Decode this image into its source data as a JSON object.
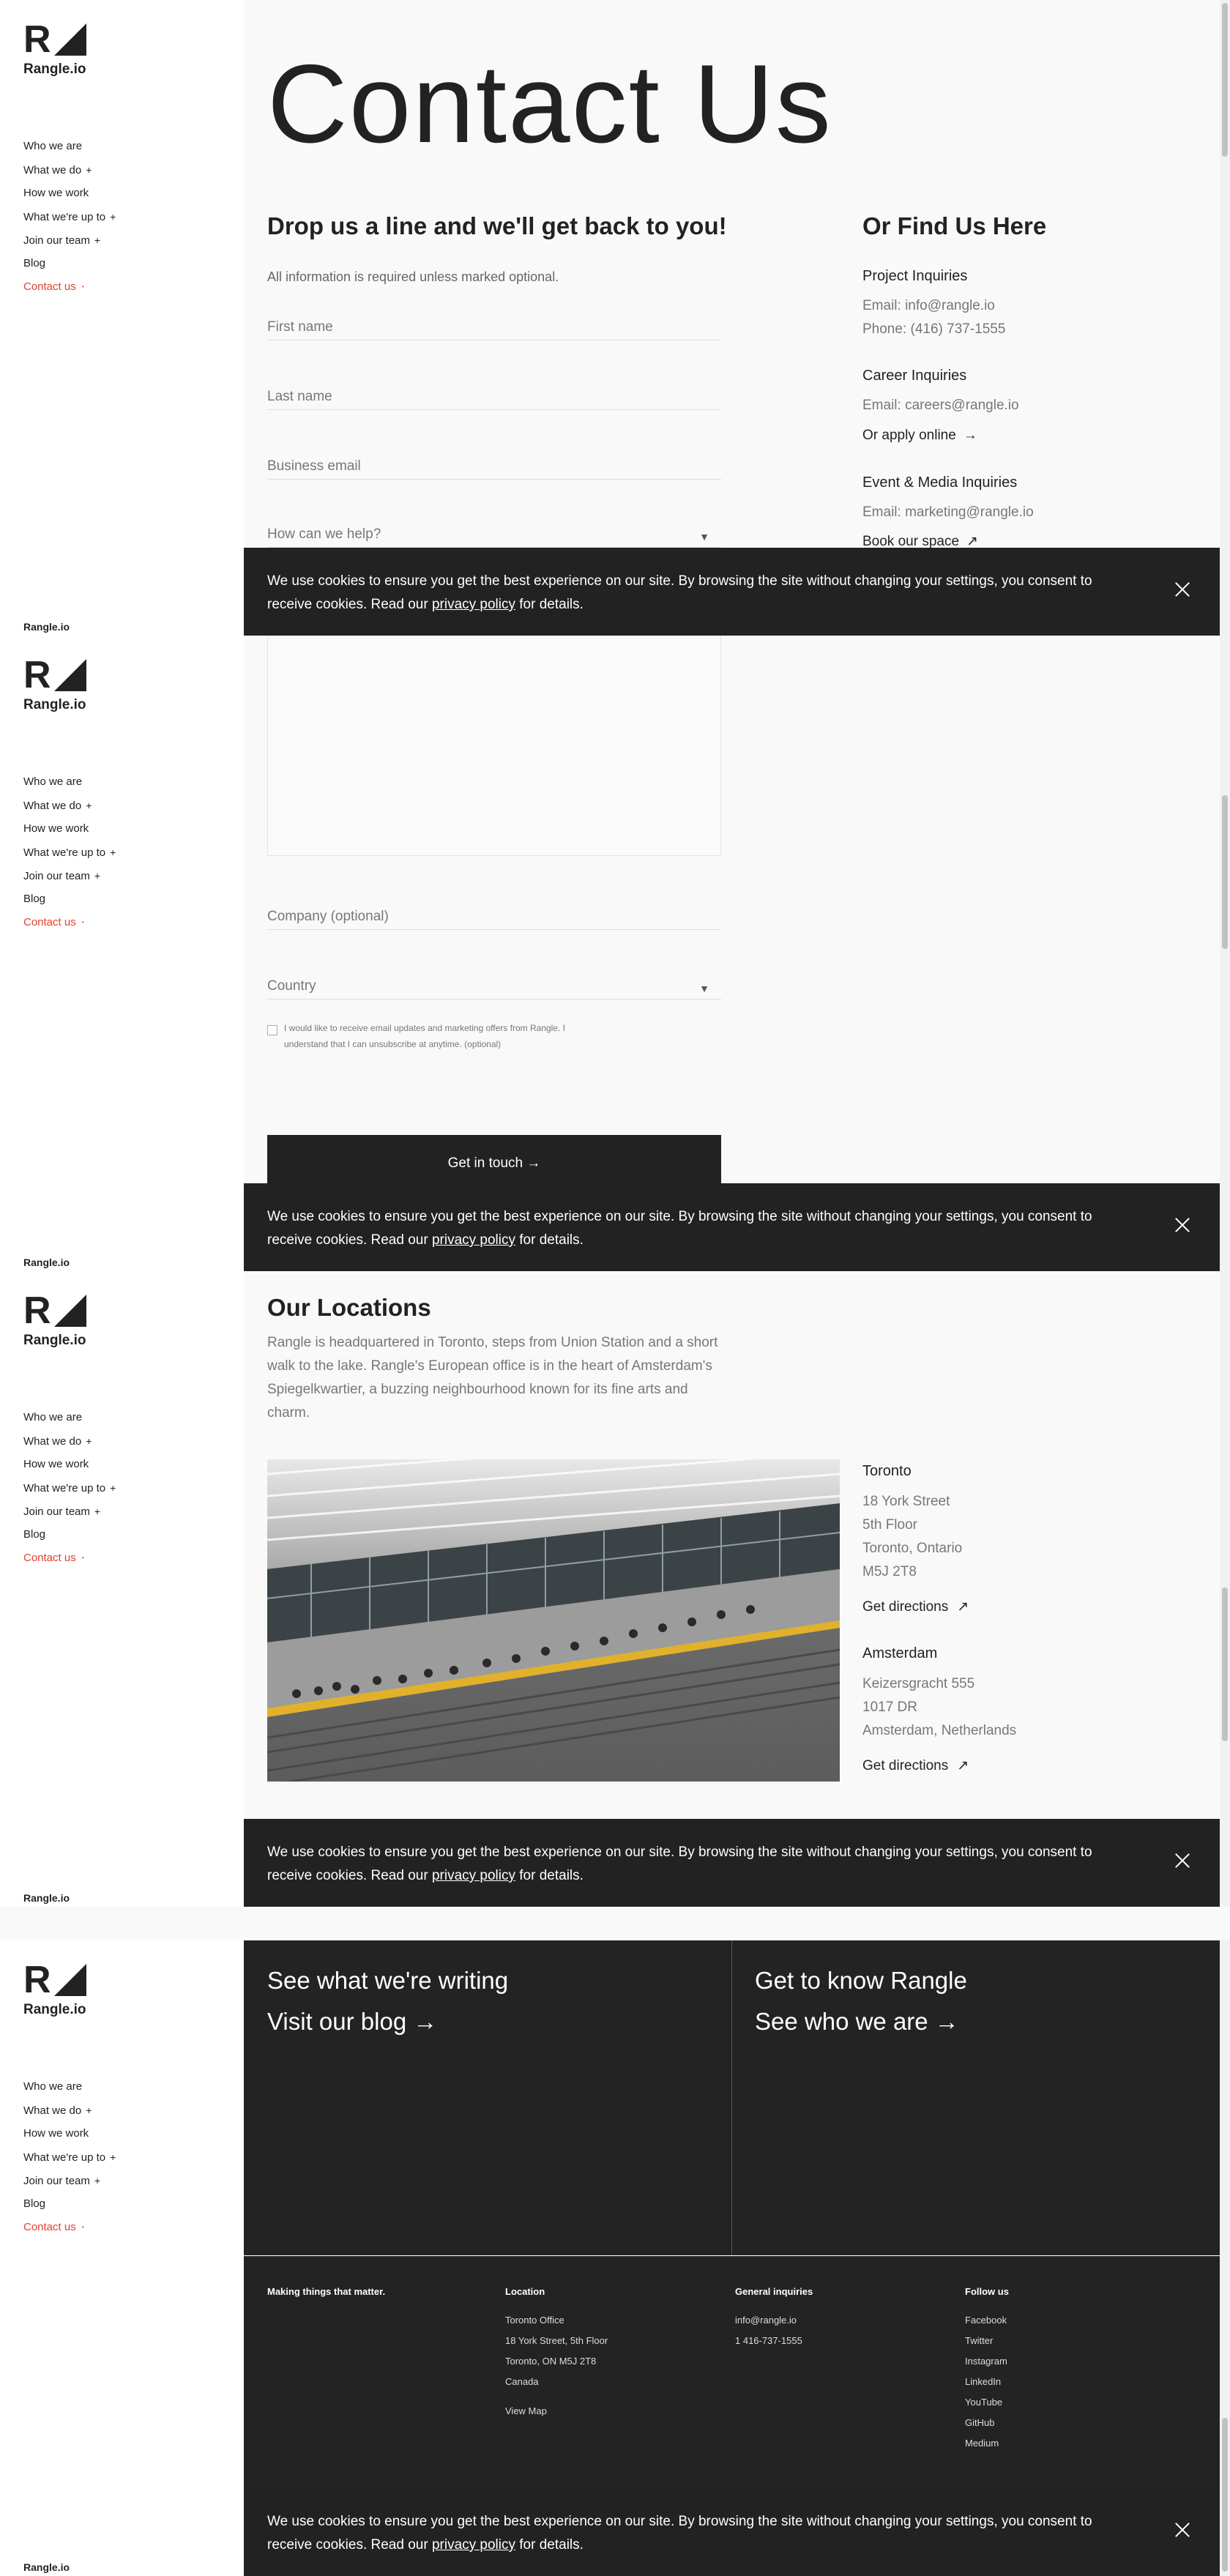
{
  "brand": {
    "name": "Rangle.io"
  },
  "nav": {
    "items": [
      {
        "label": "Who we are",
        "expand": ""
      },
      {
        "label": "What we do",
        "expand": "+"
      },
      {
        "label": "How we work",
        "expand": ""
      },
      {
        "label": "What we're up to",
        "expand": "+"
      },
      {
        "label": "Join our team",
        "expand": "+"
      },
      {
        "label": "Blog",
        "expand": ""
      },
      {
        "label": "Contact us",
        "expand": "•"
      }
    ]
  },
  "cookie": {
    "text_before": "We use cookies to ensure you get the best experience on our site. By browsing the site without changing your settings, you consent to receive cookies. Read our ",
    "link": "privacy policy",
    "text_after": " for details."
  },
  "contact": {
    "title": "Contact Us",
    "form_heading": "Drop us a line and we'll get back to you!",
    "form_note": "All information is required unless marked optional.",
    "first_name": "First name",
    "last_name": "Last name",
    "email": "Business email",
    "help": "How can we help?",
    "company": "Company (optional)",
    "country": "Country",
    "caret": "▼",
    "consent": "I would like to receive email updates and marketing offers from Rangle. I understand that I can unsubscribe at anytime. (optional)",
    "submit": "Get in touch →"
  },
  "find": {
    "heading": "Or Find Us Here",
    "project_title": "Project Inquiries",
    "project_email": "Email: info@rangle.io",
    "project_phone": "Phone: (416) 737-1555",
    "career_title": "Career Inquiries",
    "career_email": "Email: careers@rangle.io",
    "career_apply": "Or apply online",
    "career_apply_arrow": "→",
    "event_title": "Event & Media Inquiries",
    "event_email": "Email: marketing@rangle.io",
    "event_book": "Book our space",
    "event_book_arrow": "↗"
  },
  "locations": {
    "heading": "Our Locations",
    "description": "Rangle is headquartered in Toronto, steps from Union Station and a short walk to the lake. Rangle's European office is in the heart of Amsterdam's Spiegelkwartier, a buzzing neighbourhood known for its fine arts and charm.",
    "toronto": {
      "city": "Toronto",
      "lines": [
        "18 York Street",
        "5th Floor",
        "Toronto, Ontario",
        "M5J 2T8"
      ],
      "directions": "Get directions",
      "arrow": "↗"
    },
    "amsterdam": {
      "city": "Amsterdam",
      "lines": [
        "Keizersgracht 555",
        "1017 DR",
        "Amsterdam, Netherlands"
      ],
      "directions": "Get directions",
      "arrow": "↗"
    }
  },
  "promo": {
    "left_sub": "See what we're writing",
    "left_link": "Visit our blog →",
    "right_sub": "Get to know Rangle",
    "right_link": "See who we are →"
  },
  "footer": {
    "tagline": "Making things that matter.",
    "location_title": "Location",
    "location_lines": [
      "Toronto Office",
      "18 York Street, 5th Floor",
      "Toronto, ON M5J 2T8",
      "Canada"
    ],
    "view_map": "View Map",
    "general_title": "General inquiries",
    "general_lines": [
      "info@rangle.io",
      "1 416-737-1555"
    ],
    "follow_title": "Follow us",
    "social": [
      "Facebook",
      "Twitter",
      "Instagram",
      "LinkedIn",
      "YouTube",
      "GitHub",
      "Medium"
    ]
  },
  "colors": {
    "accent": "#e0412d",
    "dark": "#222222",
    "muted": "#777777"
  }
}
